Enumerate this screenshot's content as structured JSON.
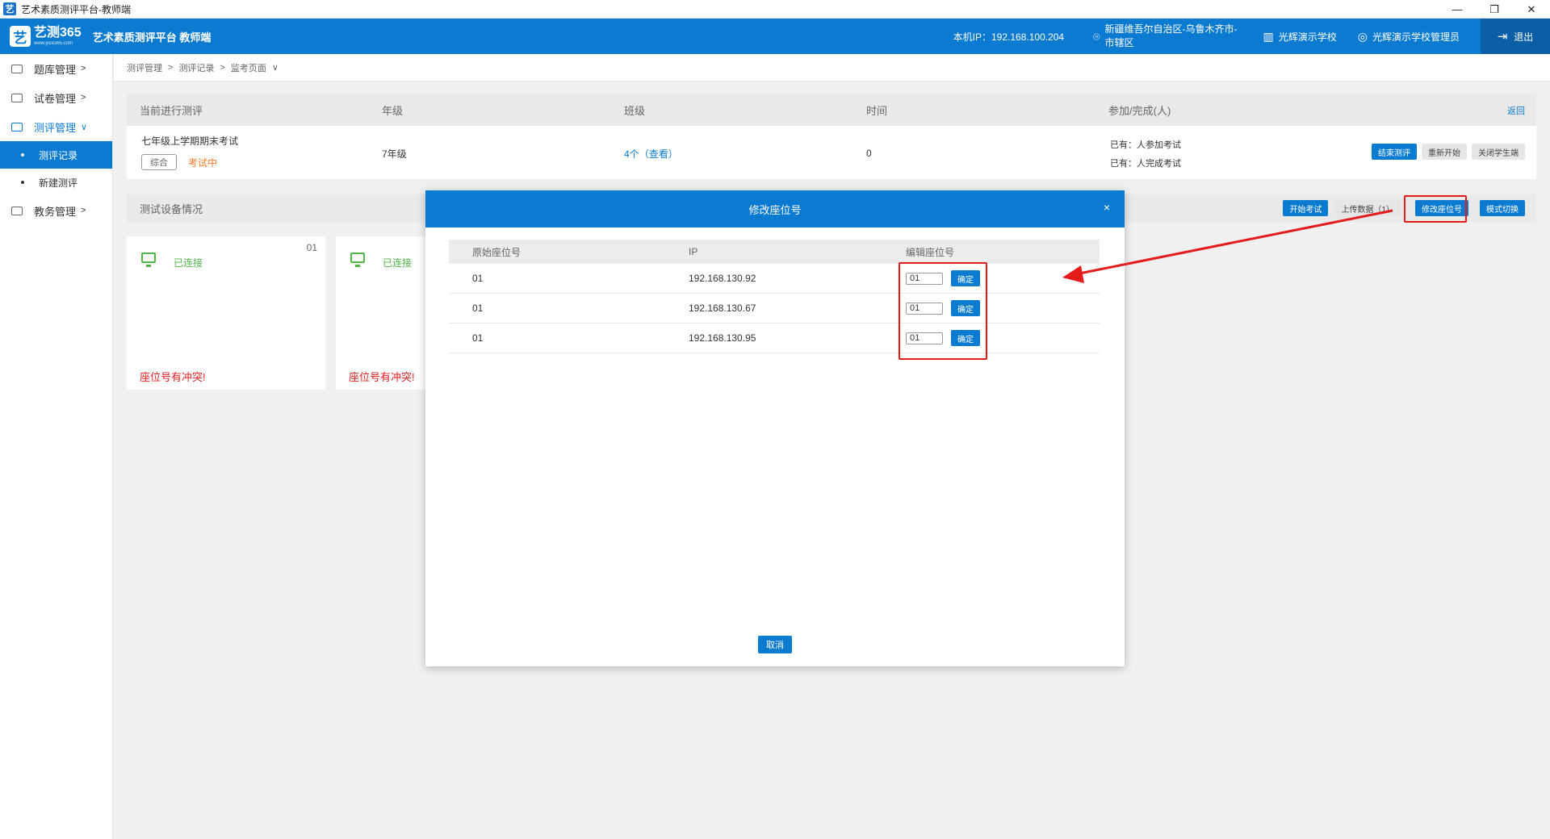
{
  "window": {
    "title": "艺术素质测评平台-教师端",
    "app_icon": "艺",
    "controls": [
      "—",
      "❐",
      "✕"
    ]
  },
  "header": {
    "logo_badge": "艺",
    "logo_text": "艺测365",
    "logo_url": "www.yice365.com",
    "platform_name": "艺术素质测评平台 教师端",
    "ip_label": "本机IP：192.168.100.204",
    "location": "新疆维吾尔自治区-乌鲁木齐市-市辖区",
    "school": "光辉演示学校",
    "admin": "光辉演示学校管理员",
    "logout": "退出"
  },
  "sidebar": {
    "items": [
      {
        "label": "题库管理",
        "chevron": ">"
      },
      {
        "label": "试卷管理",
        "chevron": ">"
      },
      {
        "label": "测评管理",
        "chevron": "∨"
      },
      {
        "label": "教务管理",
        "chevron": ">"
      }
    ],
    "sub_items": [
      {
        "label": "测评记录"
      },
      {
        "label": "新建测评"
      }
    ]
  },
  "breadcrumb": {
    "items": [
      "测评管理",
      "测评记录",
      "监考页面"
    ],
    "separator": ">",
    "dropdown": "∨"
  },
  "evaluation": {
    "headers": {
      "current": "当前进行测评",
      "grade": "年级",
      "class": "班级",
      "time": "时间",
      "participation": "参加/完成(人)",
      "back": "返回"
    },
    "row": {
      "name": "七年级上学期期末考试",
      "tag": "综合",
      "status": "考试中",
      "grade": "7年级",
      "class_count": "4个",
      "class_view": "（查看）",
      "time": "0",
      "joined": "已有：人参加考试",
      "completed": "已有：人完成考试"
    },
    "actions": {
      "end": "结束测评",
      "restart": "重新开始",
      "close_client": "关闭学生端"
    }
  },
  "devices": {
    "title": "测试设备情况",
    "actions": {
      "start": "开始考试",
      "upload": "上传数据（1）",
      "edit_seat": "修改座位号",
      "switch_mode": "模式切换"
    },
    "cards": [
      {
        "seat": "01",
        "status": "已连接",
        "warning": "座位号有冲突!"
      },
      {
        "seat": "",
        "status": "已连接",
        "warning": "座位号有冲突!"
      }
    ]
  },
  "modal": {
    "title": "修改座位号",
    "close": "×",
    "columns": [
      "原始座位号",
      "IP",
      "编辑座位号"
    ],
    "rows": [
      {
        "original": "01",
        "ip": "192.168.130.92",
        "new_seat": "01",
        "confirm": "确定"
      },
      {
        "original": "01",
        "ip": "192.168.130.67",
        "new_seat": "01",
        "confirm": "确定"
      },
      {
        "original": "01",
        "ip": "192.168.130.95",
        "new_seat": "01",
        "confirm": "确定"
      }
    ],
    "cancel": "取消"
  },
  "colors": {
    "primary": "#0b7ad1",
    "warning": "#e02020",
    "success": "#52b548",
    "status_orange": "#ff7a2e",
    "annotation": "#e31b1b"
  }
}
